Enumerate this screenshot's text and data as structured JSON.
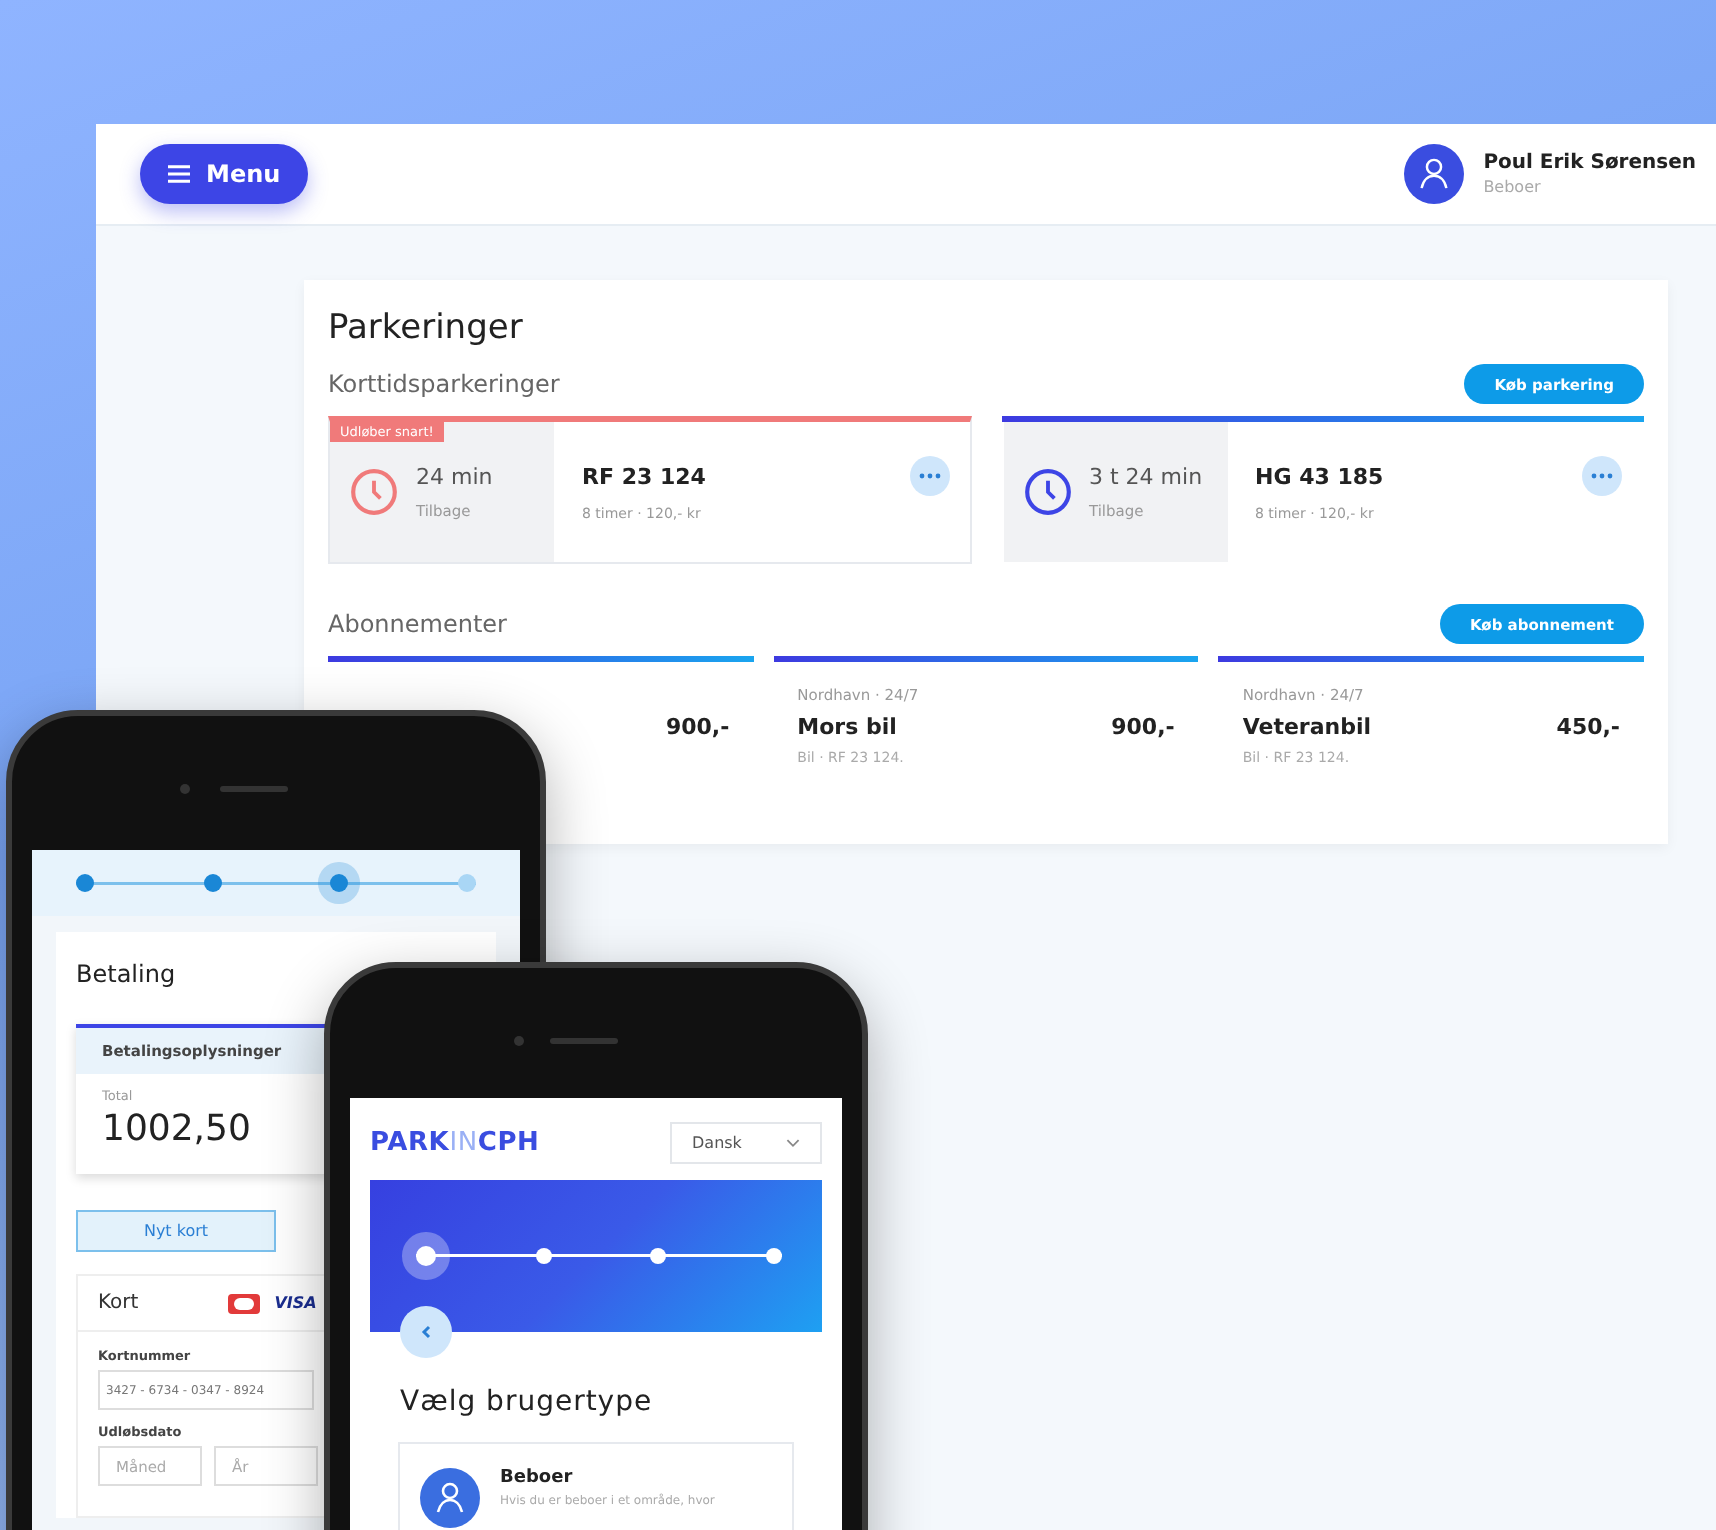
{
  "desktop": {
    "menu_button": "Menu",
    "user": {
      "name": "Poul Erik Sørensen",
      "role": "Beboer"
    },
    "page_title": "Parkeringer",
    "short_term": {
      "heading": "Korttidsparkeringer",
      "button": "Køb parkering",
      "items": [
        {
          "kind": "expiring",
          "badge": "Udløber snart!",
          "time": "24 min",
          "time_label": "Tilbage",
          "plate": "RF 23 124",
          "detail": "8 timer · 120,- kr"
        },
        {
          "kind": "normal",
          "time": "3 t 24 min",
          "time_label": "Tilbage",
          "plate": "HG 43 185",
          "detail": "8 timer · 120,- kr"
        }
      ]
    },
    "subscriptions": {
      "heading": "Abonnementer",
      "button": "Køb abonnement",
      "items": [
        {
          "price": "900,-"
        },
        {
          "location": "Nordhavn · 24/7",
          "name": "Mors bil",
          "price": "900,-",
          "detail": "Bil · RF 23 124."
        },
        {
          "location": "Nordhavn · 24/7",
          "name": "Veteranbil",
          "price": "450,-",
          "detail": "Bil · RF 23 124."
        }
      ]
    }
  },
  "phone_payment": {
    "steps": [
      {
        "selected": false
      },
      {
        "selected": false
      },
      {
        "selected": true
      },
      {
        "selected": false
      }
    ],
    "title": "Betaling",
    "summary_heading": "Betalingsoplysninger",
    "total_label": "Total",
    "total": "1002,50",
    "tabs": [
      {
        "label": "Nyt kort",
        "selected": true
      }
    ],
    "card_section": "Kort",
    "card_brand": "VISA",
    "fields": [
      {
        "label": "Kortnummer",
        "value": "3427 - 6734 - 0347 - 8924"
      }
    ],
    "expiry_label": "Udløbsdato",
    "expiry_fields": [
      {
        "placeholder": "Måned"
      },
      {
        "placeholder": "År"
      }
    ]
  },
  "phone_signup": {
    "logo": [
      {
        "text": "PARK",
        "kind": "strong"
      },
      {
        "text": "IN",
        "kind": "light"
      },
      {
        "text": "CPH",
        "kind": "strong"
      }
    ],
    "language": "Dansk",
    "steps": [
      {
        "selected": true
      },
      {
        "selected": false
      },
      {
        "selected": false
      },
      {
        "selected": false
      }
    ],
    "title": "Vælg brugertype",
    "option": {
      "name": "Beboer",
      "description": "Hvis du er beboer i et område, hvor"
    }
  }
}
